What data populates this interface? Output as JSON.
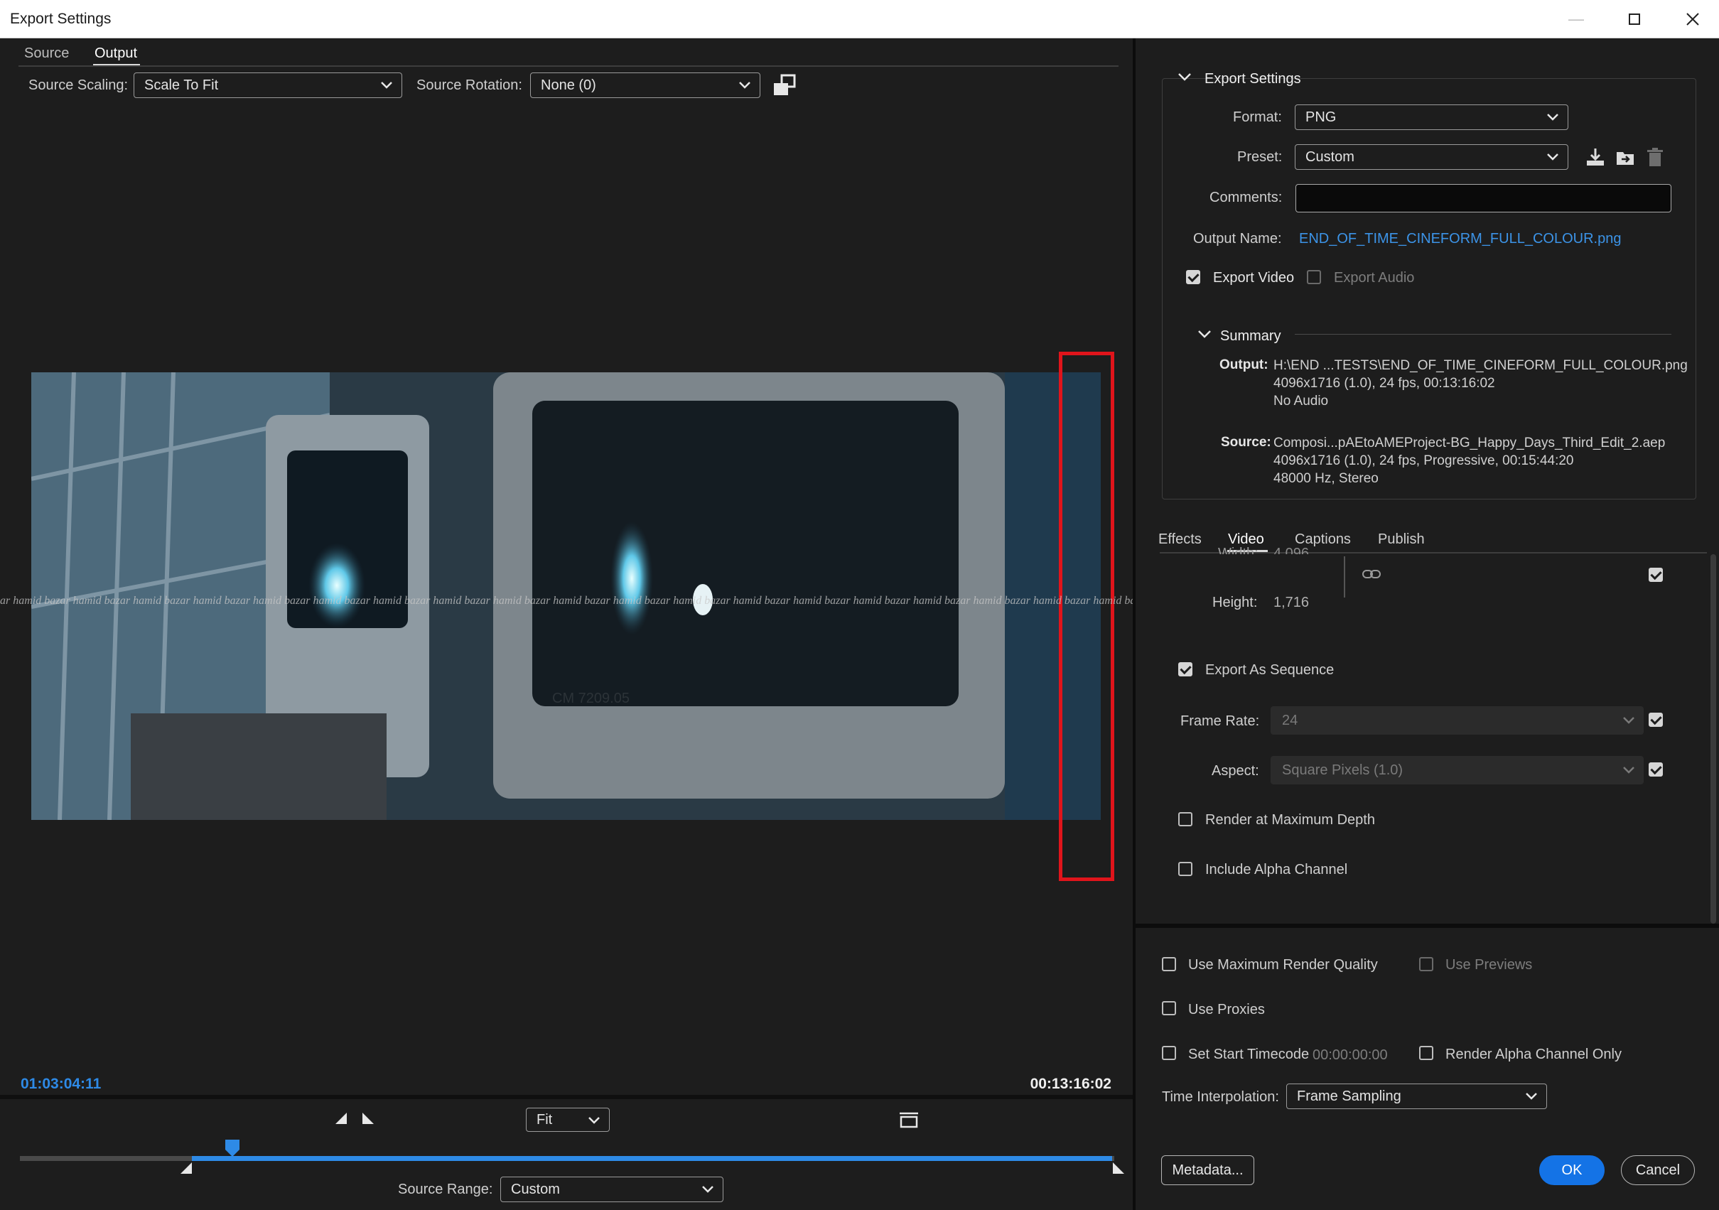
{
  "window": {
    "title": "Export Settings"
  },
  "source_tabs": [
    {
      "label": "Source"
    },
    {
      "label": "Output"
    }
  ],
  "source_scaling": {
    "label": "Source Scaling:",
    "value": "Scale To Fit"
  },
  "source_rotation": {
    "label": "Source Rotation:",
    "value": "None (0)"
  },
  "watermark_text": "ar  hamid bazar  hamid bazar  hamid bazar  hamid bazar  hamid bazar  hamid bazar  hamid bazar  hamid bazar  hamid bazar  hamid bazar  hamid bazar  hamid bazar  hamid bazar  hamid bazar  hamid bazar  hamid bazar  hamid bazar  hamid bazar  hamid bazar  hamid bazar  hamid bazar  hamid bazar",
  "preview_text": "CM 7209.05",
  "timeline": {
    "current_timecode": "01:03:04:11",
    "zoom": "Fit",
    "duration_timecode": "00:13:16:02",
    "source_range_label": "Source Range:",
    "source_range_value": "Custom"
  },
  "export_settings": {
    "section_title": "Export Settings",
    "format_label": "Format:",
    "format_value": "PNG",
    "preset_label": "Preset:",
    "preset_value": "Custom",
    "comments_label": "Comments:",
    "comments_value": "",
    "output_name_label": "Output Name:",
    "output_name_value": "END_OF_TIME_CINEFORM_FULL_COLOUR.png",
    "export_video_label": "Export Video",
    "export_audio_label": "Export Audio"
  },
  "summary": {
    "title": "Summary",
    "output_key": "Output:",
    "output_lines": [
      "H:\\END ...TESTS\\END_OF_TIME_CINEFORM_FULL_COLOUR.png",
      "4096x1716 (1.0), 24 fps, 00:13:16:02",
      "No Audio"
    ],
    "source_key": "Source:",
    "source_lines": [
      "Composi...pAEtoAMEProject-BG_Happy_Days_Third_Edit_2.aep",
      "4096x1716 (1.0), 24 fps, Progressive, 00:15:44:20",
      "48000 Hz, Stereo"
    ]
  },
  "settings_tabs": [
    {
      "label": "Effects"
    },
    {
      "label": "Video"
    },
    {
      "label": "Captions"
    },
    {
      "label": "Publish"
    }
  ],
  "video": {
    "width_label": "Width:",
    "width_value": "4,096",
    "height_label": "Height:",
    "height_value": "1,716",
    "export_as_sequence_label": "Export As Sequence",
    "frame_rate_label": "Frame Rate:",
    "frame_rate_value": "24",
    "aspect_label": "Aspect:",
    "aspect_value": "Square Pixels (1.0)",
    "render_max_depth_label": "Render at Maximum Depth",
    "include_alpha_label": "Include Alpha Channel"
  },
  "render_options": {
    "use_max_quality_label": "Use Maximum Render Quality",
    "use_previews_label": "Use Previews",
    "use_proxies_label": "Use Proxies",
    "set_start_timecode_label": "Set Start Timecode",
    "start_timecode_value": "00:00:00:00",
    "render_alpha_only_label": "Render Alpha Channel Only",
    "time_interpolation_label": "Time Interpolation:",
    "time_interpolation_value": "Frame Sampling"
  },
  "buttons": {
    "metadata": "Metadata...",
    "ok": "OK",
    "cancel": "Cancel"
  },
  "colors": {
    "accent": "#1473e6",
    "link": "#3c94e8",
    "highlight_box": "#e0141b"
  }
}
